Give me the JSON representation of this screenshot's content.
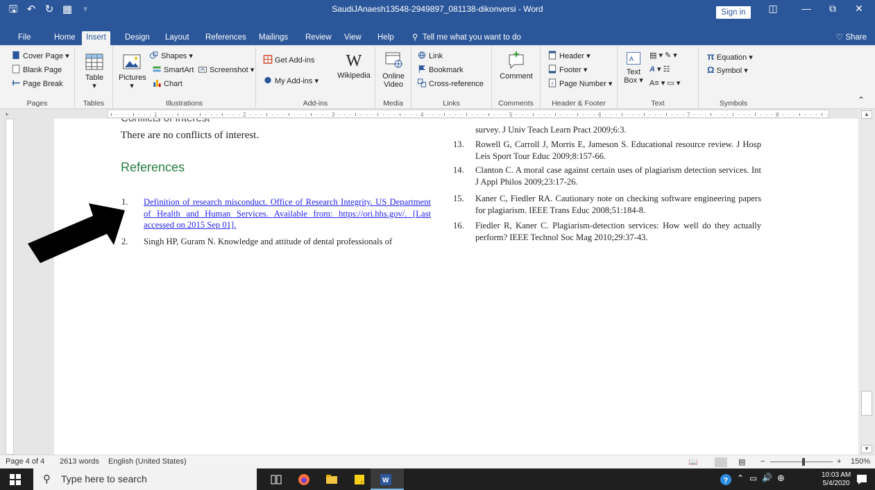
{
  "window": {
    "title": "SaudiJAnaesh13548-2949897_081138-dikonversi  -  Word",
    "sign_in": "Sign in",
    "share": "Share"
  },
  "tabs": [
    "File",
    "Home",
    "Insert",
    "Design",
    "Layout",
    "References",
    "Mailings",
    "Review",
    "View",
    "Help"
  ],
  "active_tab": "Insert",
  "tell_me": "Tell me what you want to do",
  "ribbon": {
    "pages": {
      "items": [
        "Cover Page",
        "Blank Page",
        "Page Break"
      ],
      "label": "Pages"
    },
    "tables": {
      "table": "Table",
      "label": "Tables"
    },
    "illustrations": {
      "pictures": "Pictures",
      "shapes": "Shapes",
      "smartart": "SmartArt",
      "chart": "Chart",
      "screenshot": "Screenshot",
      "label": "Illustrations"
    },
    "addins": {
      "get": "Get Add-ins",
      "my": "My Add-ins",
      "wikipedia": "Wikipedia",
      "label": "Add-ins"
    },
    "media": {
      "online_video_1": "Online",
      "online_video_2": "Video",
      "label": "Media"
    },
    "links": {
      "link": "Link",
      "bookmark": "Bookmark",
      "crossref": "Cross-reference",
      "label": "Links"
    },
    "comments": {
      "comment": "Comment",
      "label": "Comments"
    },
    "header_footer": {
      "header": "Header",
      "footer": "Footer",
      "page_number": "Page Number",
      "label": "Header & Footer"
    },
    "text": {
      "textbox_1": "Text",
      "textbox_2": "Box",
      "label": "Text"
    },
    "symbols": {
      "equation": "Equation",
      "symbol": "Symbol",
      "label": "Symbols"
    }
  },
  "document": {
    "partial_heading": "Conflicts of Interest",
    "no_conflicts": "There are no conflicts of interest.",
    "references_heading": "References",
    "left_refs": [
      {
        "num": "1.",
        "text": "Definition of research misconduct. Office of Research Integrity. US Department of Health and Human Services. Available from: https://ori.hhs.gov/. [Last accessed on 2015 Sep 01]."
      },
      {
        "num": "2.",
        "text": "Singh HP, Guram N. Knowledge and attitude of dental professionals of"
      }
    ],
    "right_partial": "survey. J Univ Teach Learn Pract 2009;6:3.",
    "right_refs": [
      {
        "num": "13.",
        "text": "Rowell G, Carroll J, Morris E, Jameson S. Educational resource review. J Hosp Leis Sport Tour Educ 2009;8:157-66."
      },
      {
        "num": "14.",
        "text": "Clanton C. A moral case against certain uses of plagiarism detection services. Int J Appl Philos 2009;23:17-26."
      },
      {
        "num": "15.",
        "text": "Kaner C, Fiedler RA. Cautionary note on checking software engineering papers for plagiarism. IEEE Trans Educ 2008;51:184-8."
      },
      {
        "num": "16.",
        "text": "Fiedler R, Kaner C. Plagiarism-detection services: How well do they actually perform? IEEE Technol Soc Mag 2010;29:37-43."
      }
    ]
  },
  "status": {
    "page": "Page 4 of 4",
    "words": "2613 words",
    "language": "English (United States)",
    "zoom": "150%"
  },
  "taskbar": {
    "search_placeholder": "Type here to search",
    "time": "10:03 AM",
    "date": "5/4/2020"
  },
  "colors": {
    "word_blue": "#2b579a",
    "heading_green": "#257c3e",
    "link_blue": "#2222ee"
  }
}
